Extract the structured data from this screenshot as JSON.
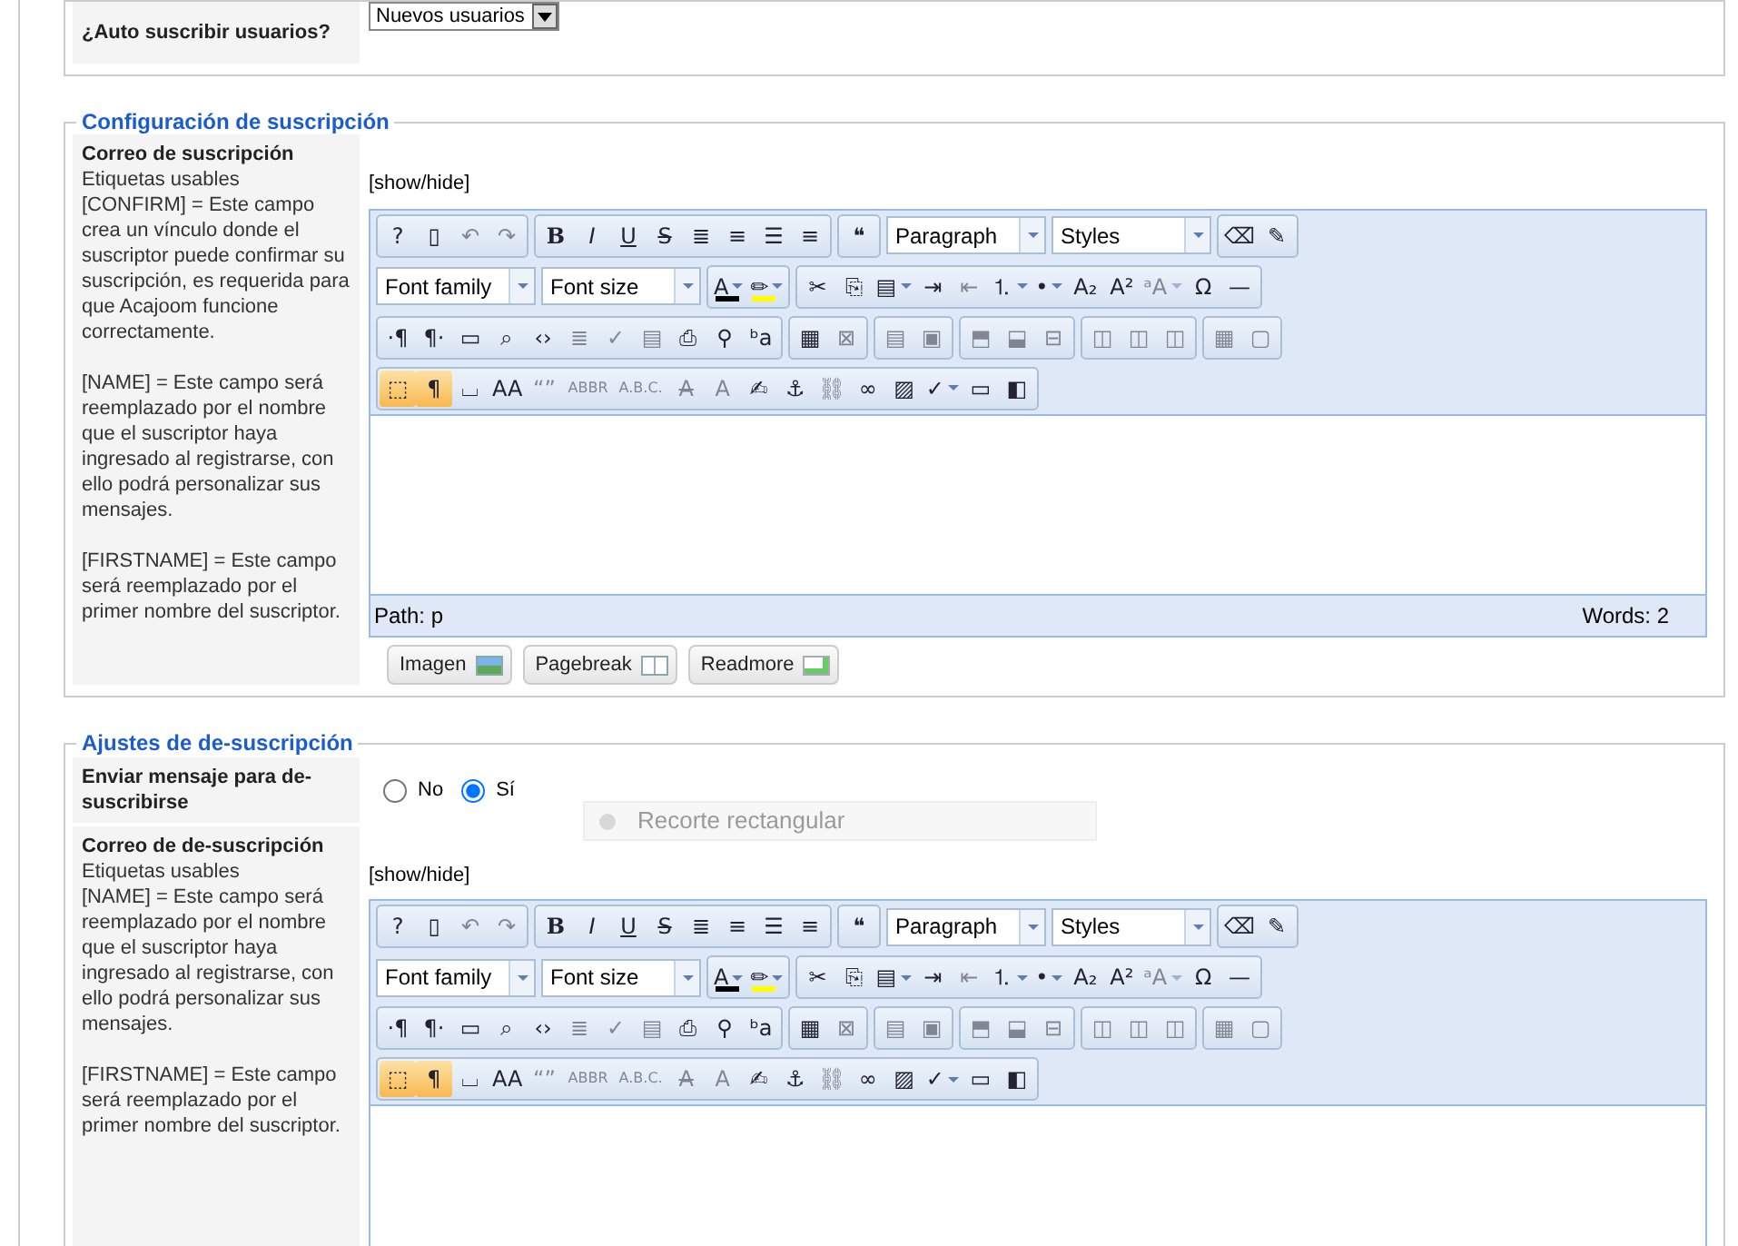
{
  "top_fieldset": {
    "label": "¿Auto suscribir usuarios?",
    "select": "Nuevos usuarios"
  },
  "fieldsets": [
    {
      "legend": "Configuración de suscripción",
      "rows": [
        {
          "kind": "editor",
          "title": "Correo de suscripción",
          "help": [
            [
              "Etiquetas usables",
              "[CONFIRM] = Este campo crea un vínculo donde el suscriptor puede confirmar su suscripción, es requerida para que Acajoom funcione correctamente."
            ],
            [
              "[NAME] = Este campo será reemplazado por el nombre que el suscriptor haya ingresado al registrarse, con ello podrá personalizar sus mensajes."
            ],
            [
              "[FIRSTNAME] = Este campo será reemplazado por el primer nombre del suscriptor."
            ]
          ],
          "toggle": "[show/hide]",
          "toolbars": [
            [
              {
                "kind": "group",
                "buttons": [
                  {
                    "glyph": "?",
                    "kind": "button",
                    "disabled": false,
                    "on": false
                  },
                  {
                    "glyph": "▯",
                    "kind": "button",
                    "disabled": false,
                    "on": false
                  },
                  {
                    "glyph": "↶",
                    "kind": "button",
                    "disabled": true,
                    "on": false
                  },
                  {
                    "glyph": "↷",
                    "kind": "button",
                    "disabled": true,
                    "on": false
                  }
                ]
              },
              {
                "kind": "group",
                "buttons": [
                  {
                    "glyph": "B",
                    "kind": "bold",
                    "disabled": false,
                    "on": false
                  },
                  {
                    "glyph": "I",
                    "kind": "italic",
                    "disabled": false,
                    "on": false
                  },
                  {
                    "glyph": "U",
                    "kind": "underline",
                    "disabled": false,
                    "on": false
                  },
                  {
                    "glyph": "S",
                    "kind": "strike",
                    "disabled": false,
                    "on": false
                  },
                  {
                    "glyph": "≣",
                    "kind": "button",
                    "disabled": false,
                    "on": false
                  },
                  {
                    "glyph": "≡",
                    "kind": "button",
                    "disabled": false,
                    "on": false
                  },
                  {
                    "glyph": "☰",
                    "kind": "button",
                    "disabled": false,
                    "on": false
                  },
                  {
                    "glyph": "≡",
                    "kind": "button",
                    "disabled": false,
                    "on": false
                  }
                ]
              },
              {
                "kind": "group",
                "buttons": [
                  {
                    "glyph": "❝",
                    "kind": "button",
                    "disabled": false,
                    "on": false
                  }
                ]
              },
              {
                "kind": "select",
                "label": "Paragraph"
              },
              {
                "kind": "select",
                "label": "Styles"
              },
              {
                "kind": "group",
                "buttons": [
                  {
                    "glyph": "⌫",
                    "kind": "button",
                    "disabled": false,
                    "on": false
                  },
                  {
                    "glyph": "✎",
                    "kind": "button",
                    "disabled": false,
                    "on": false
                  }
                ]
              }
            ],
            [
              {
                "kind": "select",
                "label": "Font family"
              },
              {
                "kind": "select",
                "label": "Font size"
              },
              {
                "kind": "group",
                "buttons": [
                  {
                    "glyph": "A",
                    "kind": "split",
                    "disabled": false,
                    "on": false,
                    "color": "#000000"
                  },
                  {
                    "glyph": "✏",
                    "kind": "split",
                    "disabled": false,
                    "on": false,
                    "color": "#ffff00"
                  }
                ]
              },
              {
                "kind": "group",
                "buttons": [
                  {
                    "glyph": "✂",
                    "kind": "button",
                    "disabled": false,
                    "on": false
                  },
                  {
                    "glyph": "⎘",
                    "kind": "button",
                    "disabled": false,
                    "on": false
                  },
                  {
                    "glyph": "▤",
                    "kind": "split",
                    "disabled": false,
                    "on": false
                  },
                  {
                    "glyph": "⇥",
                    "kind": "button",
                    "disabled": false,
                    "on": false
                  },
                  {
                    "glyph": "⇤",
                    "kind": "button",
                    "disabled": true,
                    "on": false
                  },
                  {
                    "glyph": "⒈",
                    "kind": "split",
                    "disabled": false,
                    "on": false
                  },
                  {
                    "glyph": "•",
                    "kind": "split",
                    "disabled": false,
                    "on": false
                  },
                  {
                    "glyph": "A₂",
                    "kind": "button",
                    "disabled": false,
                    "on": false
                  },
                  {
                    "glyph": "A²",
                    "kind": "button",
                    "disabled": false,
                    "on": false
                  },
                  {
                    "glyph": "ᵃA",
                    "kind": "split",
                    "disabled": true,
                    "on": false
                  },
                  {
                    "glyph": "Ω",
                    "kind": "button",
                    "disabled": false,
                    "on": false
                  },
                  {
                    "glyph": "—",
                    "kind": "button",
                    "disabled": false,
                    "on": false
                  }
                ]
              }
            ],
            [
              {
                "kind": "group",
                "buttons": [
                  {
                    "glyph": "·¶",
                    "kind": "button",
                    "disabled": false,
                    "on": false
                  },
                  {
                    "glyph": "¶·",
                    "kind": "button",
                    "disabled": false,
                    "on": false
                  },
                  {
                    "glyph": "▭",
                    "kind": "button",
                    "disabled": false,
                    "on": false
                  },
                  {
                    "glyph": "⌕",
                    "kind": "button",
                    "disabled": false,
                    "on": false
                  },
                  {
                    "glyph": "‹›",
                    "kind": "button",
                    "disabled": false,
                    "on": false
                  },
                  {
                    "glyph": "≣",
                    "kind": "button",
                    "disabled": true,
                    "on": false
                  },
                  {
                    "glyph": "✓",
                    "kind": "button",
                    "disabled": true,
                    "on": false
                  },
                  {
                    "glyph": "▤",
                    "kind": "button",
                    "disabled": true,
                    "on": false
                  },
                  {
                    "glyph": "⎙",
                    "kind": "button",
                    "disabled": false,
                    "on": false
                  },
                  {
                    "glyph": "⚲",
                    "kind": "button",
                    "disabled": false,
                    "on": false
                  },
                  {
                    "glyph": "ᵇa",
                    "kind": "button",
                    "disabled": false,
                    "on": false
                  }
                ]
              },
              {
                "kind": "group",
                "buttons": [
                  {
                    "glyph": "▦",
                    "kind": "button",
                    "disabled": false,
                    "on": false
                  },
                  {
                    "glyph": "⊠",
                    "kind": "button",
                    "disabled": true,
                    "on": false
                  }
                ]
              },
              {
                "kind": "group",
                "buttons": [
                  {
                    "glyph": "▤",
                    "kind": "button",
                    "disabled": true,
                    "on": false
                  },
                  {
                    "glyph": "▣",
                    "kind": "button",
                    "disabled": true,
                    "on": false
                  }
                ]
              },
              {
                "kind": "group",
                "buttons": [
                  {
                    "glyph": "⬒",
                    "kind": "button",
                    "disabled": true,
                    "on": false
                  },
                  {
                    "glyph": "⬓",
                    "kind": "button",
                    "disabled": true,
                    "on": false
                  },
                  {
                    "glyph": "⊟",
                    "kind": "button",
                    "disabled": true,
                    "on": false
                  }
                ]
              },
              {
                "kind": "group",
                "buttons": [
                  {
                    "glyph": "◫",
                    "kind": "button",
                    "disabled": true,
                    "on": false
                  },
                  {
                    "glyph": "◫",
                    "kind": "button",
                    "disabled": true,
                    "on": false
                  },
                  {
                    "glyph": "◫",
                    "kind": "button",
                    "disabled": true,
                    "on": false
                  }
                ]
              },
              {
                "kind": "group",
                "buttons": [
                  {
                    "glyph": "▦",
                    "kind": "button",
                    "disabled": true,
                    "on": false
                  },
                  {
                    "glyph": "▢",
                    "kind": "button",
                    "disabled": true,
                    "on": false
                  }
                ]
              }
            ],
            [
              {
                "kind": "group",
                "buttons": [
                  {
                    "glyph": "⬚",
                    "kind": "button",
                    "disabled": false,
                    "on": true
                  },
                  {
                    "glyph": "¶",
                    "kind": "button",
                    "disabled": false,
                    "on": true
                  },
                  {
                    "glyph": "⌴",
                    "kind": "button",
                    "disabled": false,
                    "on": false
                  },
                  {
                    "glyph": "AA",
                    "kind": "button",
                    "disabled": false,
                    "on": false
                  },
                  {
                    "glyph": "“”",
                    "kind": "button",
                    "disabled": true,
                    "on": false
                  },
                  {
                    "glyph": "ABBR",
                    "kind": "button",
                    "disabled": true,
                    "on": false
                  },
                  {
                    "glyph": "A.B.C.",
                    "kind": "button",
                    "disabled": true,
                    "on": false
                  },
                  {
                    "glyph": "A",
                    "kind": "strike",
                    "disabled": true,
                    "on": false
                  },
                  {
                    "glyph": "A",
                    "kind": "button",
                    "disabled": true,
                    "on": false
                  },
                  {
                    "glyph": "✍",
                    "kind": "button",
                    "disabled": false,
                    "on": false
                  },
                  {
                    "glyph": "⚓",
                    "kind": "button",
                    "disabled": false,
                    "on": false
                  },
                  {
                    "glyph": "⛓",
                    "kind": "button",
                    "disabled": true,
                    "on": false
                  },
                  {
                    "glyph": "∞",
                    "kind": "button",
                    "disabled": false,
                    "on": false
                  },
                  {
                    "glyph": "▨",
                    "kind": "button",
                    "disabled": false,
                    "on": false
                  },
                  {
                    "glyph": "✓",
                    "kind": "split",
                    "disabled": false,
                    "on": false
                  },
                  {
                    "glyph": "▭",
                    "kind": "button",
                    "disabled": false,
                    "on": false
                  },
                  {
                    "glyph": "◧",
                    "kind": "button",
                    "disabled": false,
                    "on": false
                  }
                ]
              }
            ]
          ],
          "path": "Path: p",
          "words": "Words: 2",
          "buttons": [
            {
              "label": "Imagen"
            },
            {
              "label": "Pagebreak"
            },
            {
              "label": "Readmore"
            }
          ]
        }
      ]
    },
    {
      "legend": "Ajustes de de-suscripción",
      "rows": [
        {
          "kind": "radio",
          "title": "Enviar mensaje para de-suscribirse",
          "options": [
            {
              "label": "No",
              "selected": false
            },
            {
              "label": "Sí",
              "selected": true
            }
          ]
        },
        {
          "kind": "editor",
          "title": "Correo de de-suscripción",
          "help": [
            [
              "Etiquetas usables",
              "[NAME] = Este campo será reemplazado por el nombre que el suscriptor haya ingresado al registrarse, con ello podrá personalizar sus mensajes."
            ],
            [
              "[FIRSTNAME] = Este campo será reemplazado por el primer nombre del suscriptor."
            ]
          ],
          "toggle": "[show/hide]",
          "toolbars": [
            [
              {
                "kind": "group",
                "buttons": [
                  {
                    "glyph": "?",
                    "kind": "button",
                    "disabled": false,
                    "on": false
                  },
                  {
                    "glyph": "▯",
                    "kind": "button",
                    "disabled": false,
                    "on": false
                  },
                  {
                    "glyph": "↶",
                    "kind": "button",
                    "disabled": true,
                    "on": false
                  },
                  {
                    "glyph": "↷",
                    "kind": "button",
                    "disabled": true,
                    "on": false
                  }
                ]
              },
              {
                "kind": "group",
                "buttons": [
                  {
                    "glyph": "B",
                    "kind": "bold",
                    "disabled": false,
                    "on": false
                  },
                  {
                    "glyph": "I",
                    "kind": "italic",
                    "disabled": false,
                    "on": false
                  },
                  {
                    "glyph": "U",
                    "kind": "underline",
                    "disabled": false,
                    "on": false
                  },
                  {
                    "glyph": "S",
                    "kind": "strike",
                    "disabled": false,
                    "on": false
                  },
                  {
                    "glyph": "≣",
                    "kind": "button",
                    "disabled": false,
                    "on": false
                  },
                  {
                    "glyph": "≡",
                    "kind": "button",
                    "disabled": false,
                    "on": false
                  },
                  {
                    "glyph": "☰",
                    "kind": "button",
                    "disabled": false,
                    "on": false
                  },
                  {
                    "glyph": "≡",
                    "kind": "button",
                    "disabled": false,
                    "on": false
                  }
                ]
              },
              {
                "kind": "group",
                "buttons": [
                  {
                    "glyph": "❝",
                    "kind": "button",
                    "disabled": false,
                    "on": false
                  }
                ]
              },
              {
                "kind": "select",
                "label": "Paragraph"
              },
              {
                "kind": "select",
                "label": "Styles"
              },
              {
                "kind": "group",
                "buttons": [
                  {
                    "glyph": "⌫",
                    "kind": "button",
                    "disabled": false,
                    "on": false
                  },
                  {
                    "glyph": "✎",
                    "kind": "button",
                    "disabled": false,
                    "on": false
                  }
                ]
              }
            ],
            [
              {
                "kind": "select",
                "label": "Font family"
              },
              {
                "kind": "select",
                "label": "Font size"
              },
              {
                "kind": "group",
                "buttons": [
                  {
                    "glyph": "A",
                    "kind": "split",
                    "disabled": false,
                    "on": false,
                    "color": "#000000"
                  },
                  {
                    "glyph": "✏",
                    "kind": "split",
                    "disabled": false,
                    "on": false,
                    "color": "#ffff00"
                  }
                ]
              },
              {
                "kind": "group",
                "buttons": [
                  {
                    "glyph": "✂",
                    "kind": "button",
                    "disabled": false,
                    "on": false
                  },
                  {
                    "glyph": "⎘",
                    "kind": "button",
                    "disabled": false,
                    "on": false
                  },
                  {
                    "glyph": "▤",
                    "kind": "split",
                    "disabled": false,
                    "on": false
                  },
                  {
                    "glyph": "⇥",
                    "kind": "button",
                    "disabled": false,
                    "on": false
                  },
                  {
                    "glyph": "⇤",
                    "kind": "button",
                    "disabled": true,
                    "on": false
                  },
                  {
                    "glyph": "⒈",
                    "kind": "split",
                    "disabled": false,
                    "on": false
                  },
                  {
                    "glyph": "•",
                    "kind": "split",
                    "disabled": false,
                    "on": false
                  },
                  {
                    "glyph": "A₂",
                    "kind": "button",
                    "disabled": false,
                    "on": false
                  },
                  {
                    "glyph": "A²",
                    "kind": "button",
                    "disabled": false,
                    "on": false
                  },
                  {
                    "glyph": "ᵃA",
                    "kind": "split",
                    "disabled": true,
                    "on": false
                  },
                  {
                    "glyph": "Ω",
                    "kind": "button",
                    "disabled": false,
                    "on": false
                  },
                  {
                    "glyph": "—",
                    "kind": "button",
                    "disabled": false,
                    "on": false
                  }
                ]
              }
            ],
            [
              {
                "kind": "group",
                "buttons": [
                  {
                    "glyph": "·¶",
                    "kind": "button",
                    "disabled": false,
                    "on": false
                  },
                  {
                    "glyph": "¶·",
                    "kind": "button",
                    "disabled": false,
                    "on": false
                  },
                  {
                    "glyph": "▭",
                    "kind": "button",
                    "disabled": false,
                    "on": false
                  },
                  {
                    "glyph": "⌕",
                    "kind": "button",
                    "disabled": false,
                    "on": false
                  },
                  {
                    "glyph": "‹›",
                    "kind": "button",
                    "disabled": false,
                    "on": false
                  },
                  {
                    "glyph": "≣",
                    "kind": "button",
                    "disabled": true,
                    "on": false
                  },
                  {
                    "glyph": "✓",
                    "kind": "button",
                    "disabled": true,
                    "on": false
                  },
                  {
                    "glyph": "▤",
                    "kind": "button",
                    "disabled": true,
                    "on": false
                  },
                  {
                    "glyph": "⎙",
                    "kind": "button",
                    "disabled": false,
                    "on": false
                  },
                  {
                    "glyph": "⚲",
                    "kind": "button",
                    "disabled": false,
                    "on": false
                  },
                  {
                    "glyph": "ᵇa",
                    "kind": "button",
                    "disabled": false,
                    "on": false
                  }
                ]
              },
              {
                "kind": "group",
                "buttons": [
                  {
                    "glyph": "▦",
                    "kind": "button",
                    "disabled": false,
                    "on": false
                  },
                  {
                    "glyph": "⊠",
                    "kind": "button",
                    "disabled": true,
                    "on": false
                  }
                ]
              },
              {
                "kind": "group",
                "buttons": [
                  {
                    "glyph": "▤",
                    "kind": "button",
                    "disabled": true,
                    "on": false
                  },
                  {
                    "glyph": "▣",
                    "kind": "button",
                    "disabled": true,
                    "on": false
                  }
                ]
              },
              {
                "kind": "group",
                "buttons": [
                  {
                    "glyph": "⬒",
                    "kind": "button",
                    "disabled": true,
                    "on": false
                  },
                  {
                    "glyph": "⬓",
                    "kind": "button",
                    "disabled": true,
                    "on": false
                  },
                  {
                    "glyph": "⊟",
                    "kind": "button",
                    "disabled": true,
                    "on": false
                  }
                ]
              },
              {
                "kind": "group",
                "buttons": [
                  {
                    "glyph": "◫",
                    "kind": "button",
                    "disabled": true,
                    "on": false
                  },
                  {
                    "glyph": "◫",
                    "kind": "button",
                    "disabled": true,
                    "on": false
                  },
                  {
                    "glyph": "◫",
                    "kind": "button",
                    "disabled": true,
                    "on": false
                  }
                ]
              },
              {
                "kind": "group",
                "buttons": [
                  {
                    "glyph": "▦",
                    "kind": "button",
                    "disabled": true,
                    "on": false
                  },
                  {
                    "glyph": "▢",
                    "kind": "button",
                    "disabled": true,
                    "on": false
                  }
                ]
              }
            ],
            [
              {
                "kind": "group",
                "buttons": [
                  {
                    "glyph": "⬚",
                    "kind": "button",
                    "disabled": false,
                    "on": true
                  },
                  {
                    "glyph": "¶",
                    "kind": "button",
                    "disabled": false,
                    "on": true
                  },
                  {
                    "glyph": "⌴",
                    "kind": "button",
                    "disabled": false,
                    "on": false
                  },
                  {
                    "glyph": "AA",
                    "kind": "button",
                    "disabled": false,
                    "on": false
                  },
                  {
                    "glyph": "“”",
                    "kind": "button",
                    "disabled": true,
                    "on": false
                  },
                  {
                    "glyph": "ABBR",
                    "kind": "button",
                    "disabled": true,
                    "on": false
                  },
                  {
                    "glyph": "A.B.C.",
                    "kind": "button",
                    "disabled": true,
                    "on": false
                  },
                  {
                    "glyph": "A",
                    "kind": "strike",
                    "disabled": true,
                    "on": false
                  },
                  {
                    "glyph": "A",
                    "kind": "button",
                    "disabled": true,
                    "on": false
                  },
                  {
                    "glyph": "✍",
                    "kind": "button",
                    "disabled": false,
                    "on": false
                  },
                  {
                    "glyph": "⚓",
                    "kind": "button",
                    "disabled": false,
                    "on": false
                  },
                  {
                    "glyph": "⛓",
                    "kind": "button",
                    "disabled": true,
                    "on": false
                  },
                  {
                    "glyph": "∞",
                    "kind": "button",
                    "disabled": false,
                    "on": false
                  },
                  {
                    "glyph": "▨",
                    "kind": "button",
                    "disabled": false,
                    "on": false
                  },
                  {
                    "glyph": "✓",
                    "kind": "split",
                    "disabled": false,
                    "on": false
                  },
                  {
                    "glyph": "▭",
                    "kind": "button",
                    "disabled": false,
                    "on": false
                  },
                  {
                    "glyph": "◧",
                    "kind": "button",
                    "disabled": false,
                    "on": false
                  }
                ]
              }
            ]
          ]
        }
      ]
    }
  ],
  "overlay": {
    "label": "Recorte rectangular"
  }
}
